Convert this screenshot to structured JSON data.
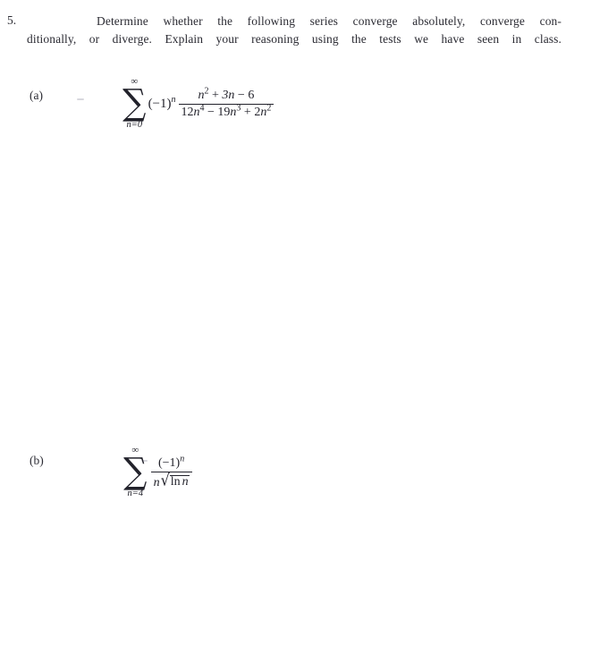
{
  "document": {
    "background_color": "#ffffff",
    "text_color": "#2b2b33"
  },
  "problem": {
    "number": "5.",
    "statement_line_1": "Determine whether the following series converge absolutely, converge con-",
    "statement_line_2": "ditionally, or diverge.  Explain your reasoning using the tests we have seen in class.",
    "statement_full": "Determine whether the following series converge absolutely, converge conditionally, or diverge. Explain your reasoning using the tests we have seen in class."
  },
  "parts": [
    {
      "label": "(a)",
      "series": {
        "operator": "∑",
        "limit_upper": "∞",
        "limit_lower": "n=0",
        "factor_text": "(−1)",
        "factor_exponent": "n",
        "numerator": "n² + 3n − 6",
        "denominator": "12n⁴ − 19n³ + 2n²",
        "numerator_parts": {
          "n_var": "n",
          "n_exp": "2",
          "plus": "+",
          "three_n": "3n",
          "minus": "−",
          "six": "6"
        },
        "denominator_parts": {
          "twelve": "12",
          "n_var": "n",
          "exp4": "4",
          "minus": "−",
          "nineteen": "19",
          "exp3": "3",
          "plus": "+",
          "two": "2",
          "exp2": "2"
        },
        "latex": "\\sum_{n=0}^{\\infty}(-1)^n \\frac{n^2+3n-6}{12n^4-19n^3+2n^2}"
      }
    },
    {
      "label": "(b)",
      "series": {
        "operator": "∑",
        "limit_upper": "∞",
        "limit_lower": "n=4",
        "numerator": "(−1)ⁿ",
        "numerator_parts": {
          "base": "(−1)",
          "exponent": "n"
        },
        "denominator": "n√(ln n)",
        "denominator_parts": {
          "n_var": "n",
          "radical_sign": "√",
          "radicand": "ln n",
          "log_op": "ln",
          "log_arg": "n"
        },
        "latex": "\\sum_{n=4}^{\\infty}\\frac{(-1)^n}{n\\sqrt{\\ln n}}"
      }
    }
  ]
}
